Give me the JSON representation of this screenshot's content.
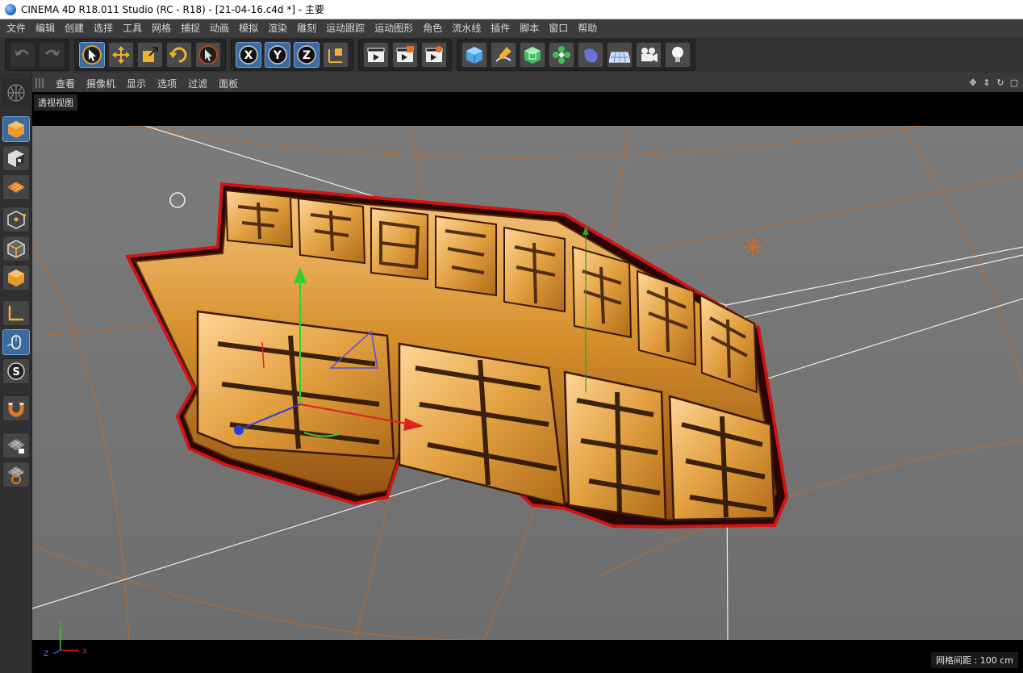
{
  "window": {
    "title": "CINEMA 4D R18.011 Studio (RC - R18) - [21-04-16.c4d *] - 主要"
  },
  "menu": [
    "文件",
    "编辑",
    "创建",
    "选择",
    "工具",
    "网格",
    "捕捉",
    "动画",
    "模拟",
    "渲染",
    "雕刻",
    "运动跟踪",
    "运动图形",
    "角色",
    "流水线",
    "插件",
    "脚本",
    "窗口",
    "帮助"
  ],
  "toolbar": {
    "groups": [
      {
        "name": "history",
        "items": [
          "undo-icon",
          "redo-icon"
        ]
      },
      {
        "name": "transform",
        "items": [
          "live-select-icon",
          "move-icon",
          "scale-icon",
          "rotate-icon",
          "recent-tool-icon"
        ]
      },
      {
        "name": "axes",
        "items": [
          "x-axis-icon",
          "y-axis-icon",
          "z-axis-icon",
          "coordinate-system-icon"
        ]
      },
      {
        "name": "render",
        "items": [
          "render-view-icon",
          "render-picture-viewer-icon",
          "render-settings-icon"
        ]
      },
      {
        "name": "objects",
        "items": [
          "cube-icon",
          "pen-icon",
          "subdivision-icon",
          "cloner-icon",
          "deformer-icon",
          "floor-icon",
          "camera-icon",
          "light-icon"
        ]
      }
    ],
    "axis_labels": [
      "X",
      "Y",
      "Z"
    ]
  },
  "left_tools": [
    "model-mode-icon",
    "texture-mode-icon",
    "workplane-icon",
    "points-mode-icon",
    "edges-mode-icon",
    "polygons-mode-icon",
    "axis-mode-icon",
    "tweak-mode-icon",
    "solo-icon",
    "snap-magnet-icon",
    "workplane-lock-icon",
    "locked-workplane-icon"
  ],
  "view_menu": [
    "查看",
    "摄像机",
    "显示",
    "选项",
    "过滤",
    "面板"
  ],
  "viewport": {
    "label": "透视视图",
    "grid_spacing": "网格间距 : 100 cm",
    "axis": {
      "y": "Y",
      "z": "Z",
      "x": "X"
    }
  },
  "colors": {
    "gold": "#d58f2b",
    "red_outline": "#d01414",
    "background_gray": "#7a7a7a",
    "accent_blue": "#3d6a9f"
  }
}
